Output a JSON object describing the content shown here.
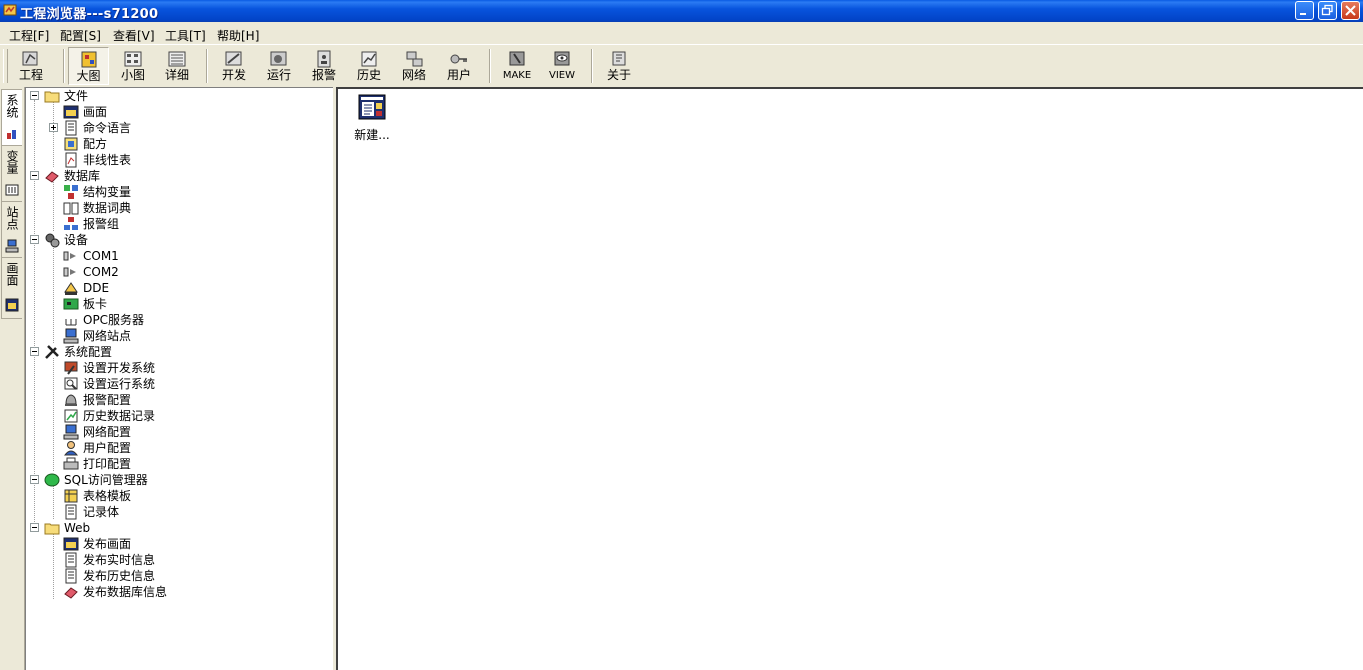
{
  "window": {
    "title": "工程浏览器---s71200"
  },
  "menu": [
    "工程[F]",
    "配置[S]",
    "查看[V]",
    "工具[T]",
    "帮助[H]"
  ],
  "toolbar": {
    "project": "工程",
    "large": "大图",
    "small": "小图",
    "detail": "详细",
    "develop": "开发",
    "run": "运行",
    "alarm": "报警",
    "history": "历史",
    "network": "网络",
    "user": "用户",
    "make": "MAKE",
    "view": "VIEW",
    "about": "关于"
  },
  "side_tabs": [
    "系统",
    "变量",
    "站点",
    "画面"
  ],
  "tree": {
    "file": "文件",
    "screen": "画面",
    "command_language": "命令语言",
    "recipe": "配方",
    "nonlinear_table": "非线性表",
    "database": "数据库",
    "struct_var": "结构变量",
    "data_dict": "数据词典",
    "alarm_group": "报警组",
    "device": "设备",
    "com1": "COM1",
    "com2": "COM2",
    "dde": "DDE",
    "board": "板卡",
    "opc_server": "OPC服务器",
    "net_station": "网络站点",
    "sys_config": "系统配置",
    "set_dev_sys": "设置开发系统",
    "set_run_sys": "设置运行系统",
    "alarm_config": "报警配置",
    "history_record": "历史数据记录",
    "net_config": "网络配置",
    "user_config": "用户配置",
    "print_config": "打印配置",
    "sql_manager": "SQL访问管理器",
    "table_template": "表格模板",
    "recordset": "记录体",
    "web": "Web",
    "publish_screen": "发布画面",
    "publish_realtime": "发布实时信息",
    "publish_history": "发布历史信息",
    "publish_db": "发布数据库信息"
  },
  "content": {
    "new_item": "新建..."
  }
}
